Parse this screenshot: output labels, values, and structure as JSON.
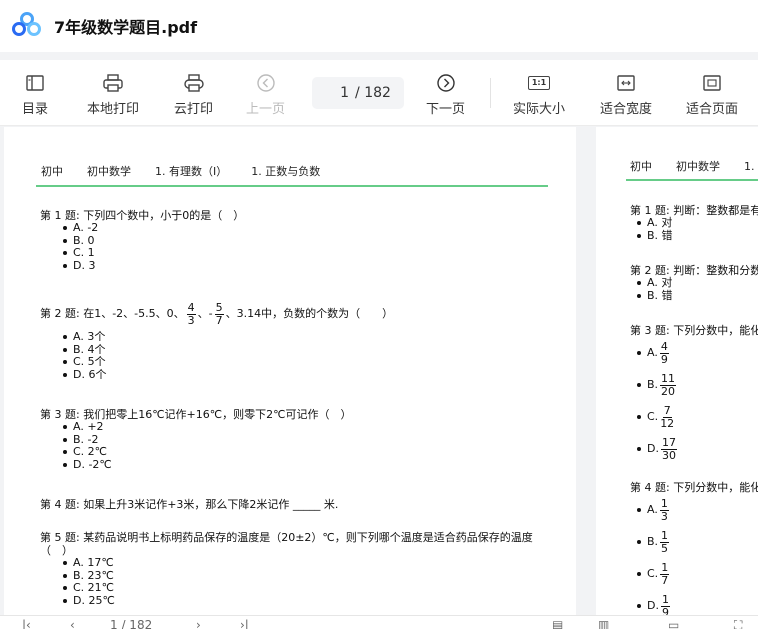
{
  "app": {
    "title": "7年级数学题目.pdf"
  },
  "toolbar": {
    "catalog": "目录",
    "local_print": "本地打印",
    "cloud_print": "云打印",
    "prev_page": "上一页",
    "current_page": "1",
    "total_pages": "/ 182",
    "next_page": "下一页",
    "actual_size": "实际大小",
    "actual_size_glyph": "1:1",
    "fit_width": "适合宽度",
    "fit_page": "适合页面"
  },
  "page1": {
    "crumbs": [
      "初中",
      "初中数学",
      "1. 有理数（I）",
      "1. 正数与负数"
    ],
    "questions": [
      {
        "text": "第 1 题: 下列四个数中，小于0的是（　）",
        "options": [
          "A. -2",
          "B. 0",
          "C. 1",
          "D. 3"
        ]
      },
      {
        "text_a": "第 2 题: 在1、-2、-5.5、0、",
        "f1n": "4",
        "f1d": "3",
        "text_b": "、-",
        "f2n": "5",
        "f2d": "7",
        "text_c": "、3.14中，负数的个数为（　　）",
        "options": [
          "A. 3个",
          "B. 4个",
          "C. 5个",
          "D. 6个"
        ]
      },
      {
        "text": "第 3 题: 我们把零上16℃记作+16℃，则零下2℃可记作（　）",
        "options": [
          "A. +2",
          "B. -2",
          "C. 2℃",
          "D. -2℃"
        ]
      },
      {
        "text": "第 4 题: 如果上升3米记作+3米，那么下降2米记作 _____ 米."
      },
      {
        "text": "第 5 题: 某药品说明书上标明药品保存的温度是（20±2）℃，则下列哪个温度是适合药品保存的温度（　）",
        "options": [
          "A. 17℃",
          "B. 23℃",
          "C. 21℃",
          "D. 25℃"
        ]
      }
    ]
  },
  "page2": {
    "crumbs": [
      "初中",
      "初中数学",
      "1."
    ],
    "q1": {
      "text": "第 1 题: 判断：整数都是有",
      "options": [
        "A. 对",
        "B. 错"
      ]
    },
    "q2": {
      "text": "第 2 题: 判断：整数和分数",
      "options": [
        "A. 对",
        "B. 错"
      ]
    },
    "q3": {
      "text": "第 3 题: 下列分数中，能化",
      "options": [
        {
          "l": "A.",
          "n": "4",
          "d": "9"
        },
        {
          "l": "B.",
          "n": "11",
          "d": "20"
        },
        {
          "l": "C.",
          "n": "7",
          "d": "12"
        },
        {
          "l": "D.",
          "n": "17",
          "d": "30"
        }
      ]
    },
    "q4": {
      "text": "第 4 题: 下列分数中，能化",
      "options": [
        {
          "l": "A.",
          "n": "1",
          "d": "3"
        },
        {
          "l": "B.",
          "n": "1",
          "d": "5"
        },
        {
          "l": "C.",
          "n": "1",
          "d": "7"
        },
        {
          "l": "D.",
          "n": "1",
          "d": "9"
        }
      ]
    }
  },
  "bottombar": {
    "page_indicator": "1 / 182"
  },
  "colors": {
    "accent": "#3d7cf5",
    "divider_green": "#66cc88",
    "background": "#f2f3f5"
  }
}
